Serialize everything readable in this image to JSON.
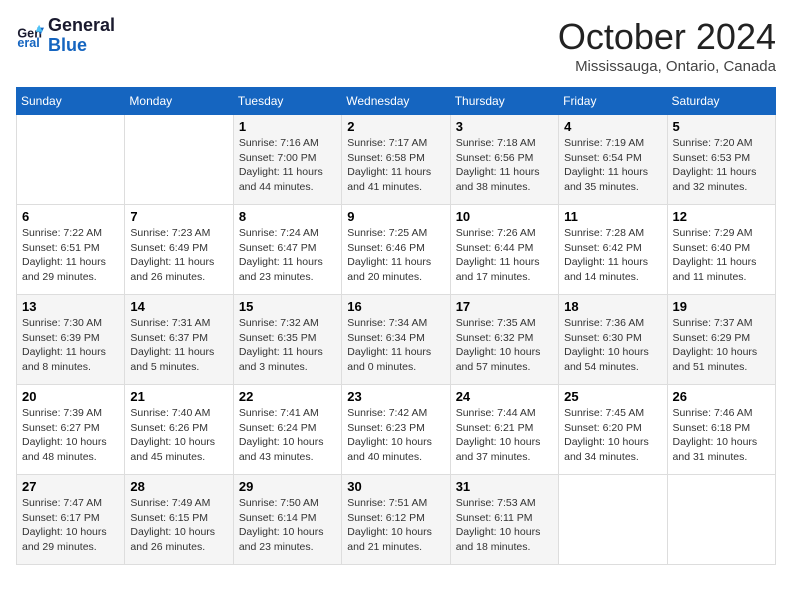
{
  "header": {
    "logo_line1": "General",
    "logo_line2": "Blue",
    "month": "October 2024",
    "location": "Mississauga, Ontario, Canada"
  },
  "weekdays": [
    "Sunday",
    "Monday",
    "Tuesday",
    "Wednesday",
    "Thursday",
    "Friday",
    "Saturday"
  ],
  "weeks": [
    [
      {
        "day": null
      },
      {
        "day": null
      },
      {
        "day": "1",
        "sunrise": "7:16 AM",
        "sunset": "7:00 PM",
        "daylight": "11 hours and 44 minutes."
      },
      {
        "day": "2",
        "sunrise": "7:17 AM",
        "sunset": "6:58 PM",
        "daylight": "11 hours and 41 minutes."
      },
      {
        "day": "3",
        "sunrise": "7:18 AM",
        "sunset": "6:56 PM",
        "daylight": "11 hours and 38 minutes."
      },
      {
        "day": "4",
        "sunrise": "7:19 AM",
        "sunset": "6:54 PM",
        "daylight": "11 hours and 35 minutes."
      },
      {
        "day": "5",
        "sunrise": "7:20 AM",
        "sunset": "6:53 PM",
        "daylight": "11 hours and 32 minutes."
      }
    ],
    [
      {
        "day": "6",
        "sunrise": "7:22 AM",
        "sunset": "6:51 PM",
        "daylight": "11 hours and 29 minutes."
      },
      {
        "day": "7",
        "sunrise": "7:23 AM",
        "sunset": "6:49 PM",
        "daylight": "11 hours and 26 minutes."
      },
      {
        "day": "8",
        "sunrise": "7:24 AM",
        "sunset": "6:47 PM",
        "daylight": "11 hours and 23 minutes."
      },
      {
        "day": "9",
        "sunrise": "7:25 AM",
        "sunset": "6:46 PM",
        "daylight": "11 hours and 20 minutes."
      },
      {
        "day": "10",
        "sunrise": "7:26 AM",
        "sunset": "6:44 PM",
        "daylight": "11 hours and 17 minutes."
      },
      {
        "day": "11",
        "sunrise": "7:28 AM",
        "sunset": "6:42 PM",
        "daylight": "11 hours and 14 minutes."
      },
      {
        "day": "12",
        "sunrise": "7:29 AM",
        "sunset": "6:40 PM",
        "daylight": "11 hours and 11 minutes."
      }
    ],
    [
      {
        "day": "13",
        "sunrise": "7:30 AM",
        "sunset": "6:39 PM",
        "daylight": "11 hours and 8 minutes."
      },
      {
        "day": "14",
        "sunrise": "7:31 AM",
        "sunset": "6:37 PM",
        "daylight": "11 hours and 5 minutes."
      },
      {
        "day": "15",
        "sunrise": "7:32 AM",
        "sunset": "6:35 PM",
        "daylight": "11 hours and 3 minutes."
      },
      {
        "day": "16",
        "sunrise": "7:34 AM",
        "sunset": "6:34 PM",
        "daylight": "11 hours and 0 minutes."
      },
      {
        "day": "17",
        "sunrise": "7:35 AM",
        "sunset": "6:32 PM",
        "daylight": "10 hours and 57 minutes."
      },
      {
        "day": "18",
        "sunrise": "7:36 AM",
        "sunset": "6:30 PM",
        "daylight": "10 hours and 54 minutes."
      },
      {
        "day": "19",
        "sunrise": "7:37 AM",
        "sunset": "6:29 PM",
        "daylight": "10 hours and 51 minutes."
      }
    ],
    [
      {
        "day": "20",
        "sunrise": "7:39 AM",
        "sunset": "6:27 PM",
        "daylight": "10 hours and 48 minutes."
      },
      {
        "day": "21",
        "sunrise": "7:40 AM",
        "sunset": "6:26 PM",
        "daylight": "10 hours and 45 minutes."
      },
      {
        "day": "22",
        "sunrise": "7:41 AM",
        "sunset": "6:24 PM",
        "daylight": "10 hours and 43 minutes."
      },
      {
        "day": "23",
        "sunrise": "7:42 AM",
        "sunset": "6:23 PM",
        "daylight": "10 hours and 40 minutes."
      },
      {
        "day": "24",
        "sunrise": "7:44 AM",
        "sunset": "6:21 PM",
        "daylight": "10 hours and 37 minutes."
      },
      {
        "day": "25",
        "sunrise": "7:45 AM",
        "sunset": "6:20 PM",
        "daylight": "10 hours and 34 minutes."
      },
      {
        "day": "26",
        "sunrise": "7:46 AM",
        "sunset": "6:18 PM",
        "daylight": "10 hours and 31 minutes."
      }
    ],
    [
      {
        "day": "27",
        "sunrise": "7:47 AM",
        "sunset": "6:17 PM",
        "daylight": "10 hours and 29 minutes."
      },
      {
        "day": "28",
        "sunrise": "7:49 AM",
        "sunset": "6:15 PM",
        "daylight": "10 hours and 26 minutes."
      },
      {
        "day": "29",
        "sunrise": "7:50 AM",
        "sunset": "6:14 PM",
        "daylight": "10 hours and 23 minutes."
      },
      {
        "day": "30",
        "sunrise": "7:51 AM",
        "sunset": "6:12 PM",
        "daylight": "10 hours and 21 minutes."
      },
      {
        "day": "31",
        "sunrise": "7:53 AM",
        "sunset": "6:11 PM",
        "daylight": "10 hours and 18 minutes."
      },
      {
        "day": null
      },
      {
        "day": null
      }
    ]
  ]
}
